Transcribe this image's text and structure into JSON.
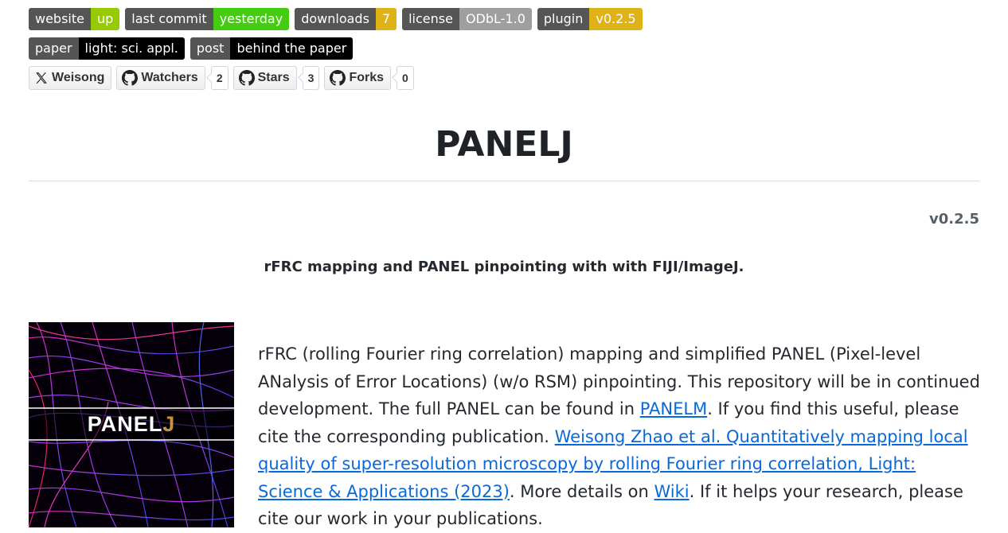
{
  "badges_row1": [
    {
      "label": "website",
      "value": "up",
      "color": "#97ca00"
    },
    {
      "label": "last commit",
      "value": "yesterday",
      "color": "#4c1"
    },
    {
      "label": "downloads",
      "value": "7",
      "color": "#dfb317"
    },
    {
      "label": "license",
      "value": "ODbL-1.0",
      "color": "#9f9f9f"
    },
    {
      "label": "plugin",
      "value": "v0.2.5",
      "color": "#dfb317"
    }
  ],
  "badges_row2": [
    {
      "label": "paper",
      "value": "light: sci. appl.",
      "color": "#000000"
    },
    {
      "label": "post",
      "value": "behind the paper",
      "color": "#000000"
    }
  ],
  "social": {
    "twitter": {
      "label": "Weisong",
      "icon": "x-icon"
    },
    "watchers": {
      "label": "Watchers",
      "count": "2",
      "icon": "github-icon"
    },
    "stars": {
      "label": "Stars",
      "count": "3",
      "icon": "github-icon"
    },
    "forks": {
      "label": "Forks",
      "count": "0",
      "icon": "github-icon"
    }
  },
  "title": "PANELJ",
  "version": "v0.2.5",
  "subtitle": "rFRC mapping and PANEL pinpointing with with FIJI/ImageJ.",
  "logo": {
    "text_main": "PANEL",
    "text_accent": "J",
    "accent_color": "#c8923a"
  },
  "description": {
    "p1": "rFRC (rolling Fourier ring correlation) mapping and simplified PANEL (Pixel-level ANalysis of Error Locations) (w/o RSM) pinpointing. This repository will be in continued development. The full PANEL can be found in ",
    "link_panelm": "PANELM",
    "p2": ". If you find this useful, please cite the corresponding publication. ",
    "link_paper": "Weisong Zhao et al. Quantitatively mapping local quality of super-resolution microscopy by rolling Fourier ring correlation, Light: Science & Applications (2023)",
    "p3": ". More details on ",
    "link_wiki": "Wiki",
    "p4": ". If it helps your research, please cite our work in your publications."
  }
}
